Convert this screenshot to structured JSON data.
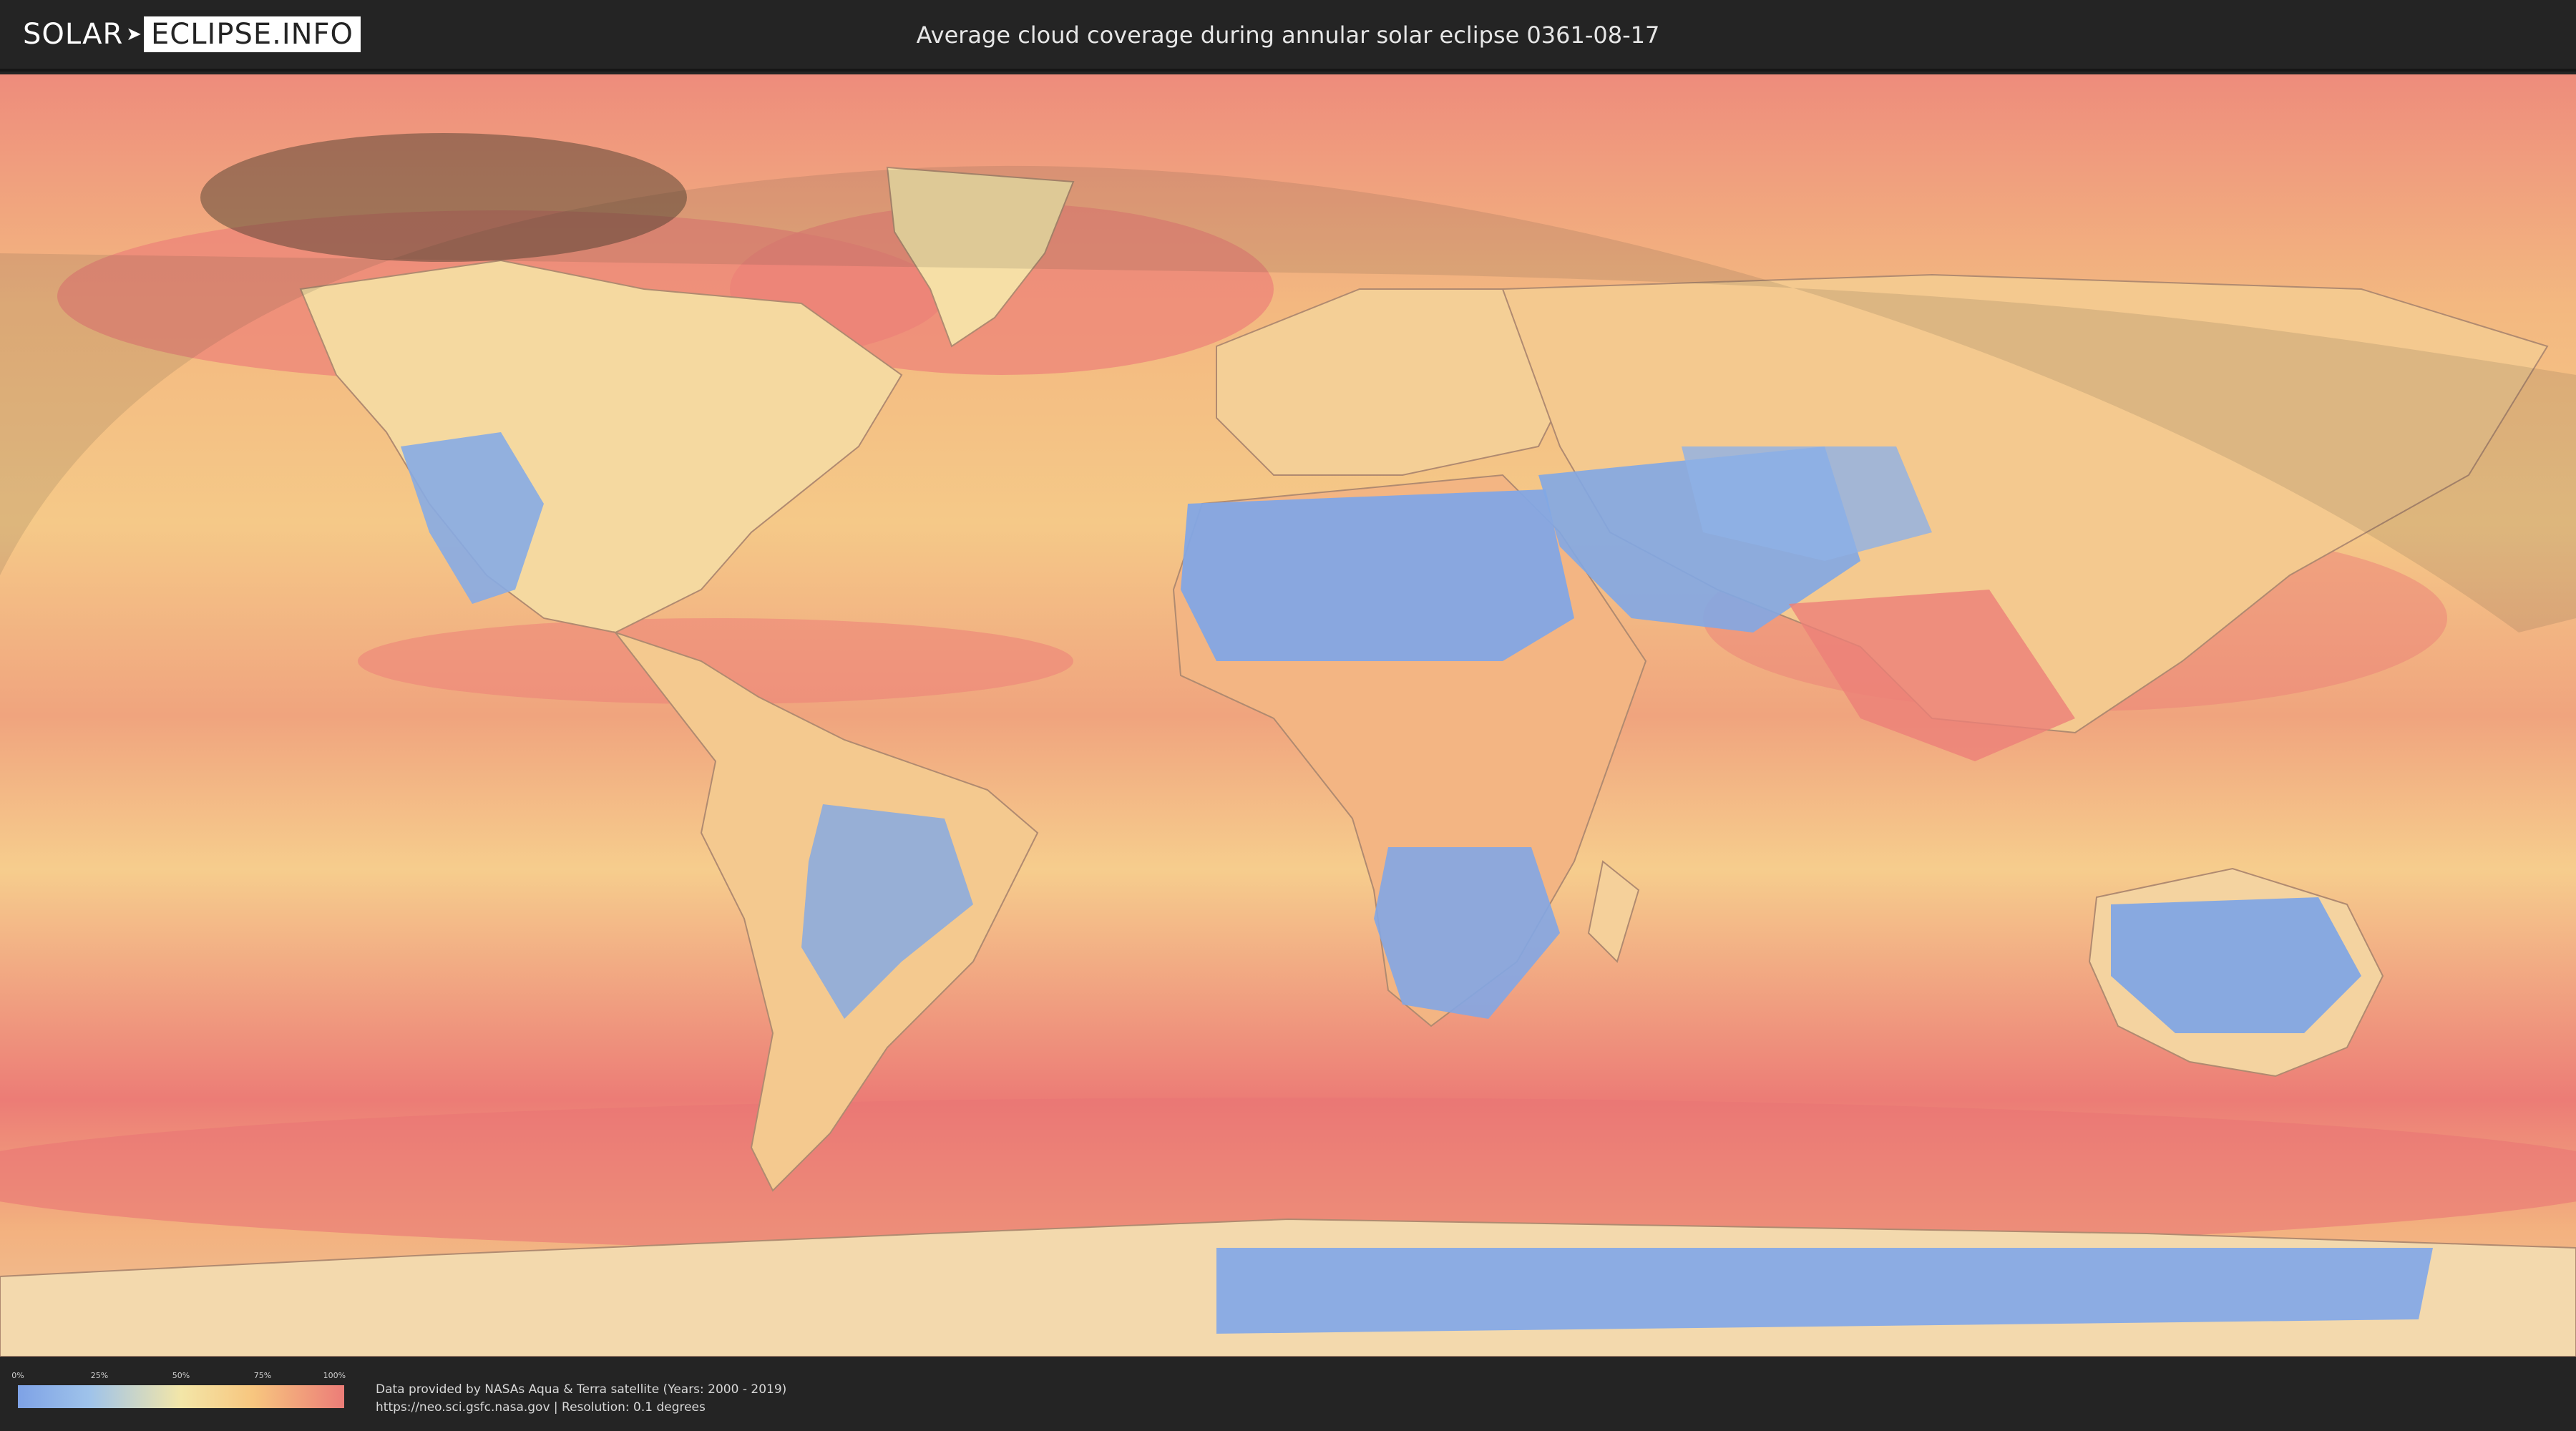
{
  "header": {
    "logo_left": "SOLAR",
    "logo_right": "ECLIPSE.INFO",
    "title": "Average cloud coverage during annular solar eclipse 0361-08-17"
  },
  "legend": {
    "ticks": [
      "0%",
      "25%",
      "50%",
      "75%",
      "100%"
    ],
    "colors": [
      "#7ea2e6",
      "#9fc3ea",
      "#f3e6a8",
      "#f7c67f",
      "#ec7d78"
    ]
  },
  "footer": {
    "credit_line1": "Data provided by NASAs Aqua & Terra satellite (Years: 2000 - 2019)",
    "credit_line2": "https://neo.sci.gsfc.nasa.gov | Resolution: 0.1 degrees"
  },
  "map": {
    "colors": {
      "ocean_cloudy": "#ec7d78",
      "mid": "#f7c67f",
      "clear": "#7ea2e6",
      "shadow": "#5a5040"
    }
  }
}
